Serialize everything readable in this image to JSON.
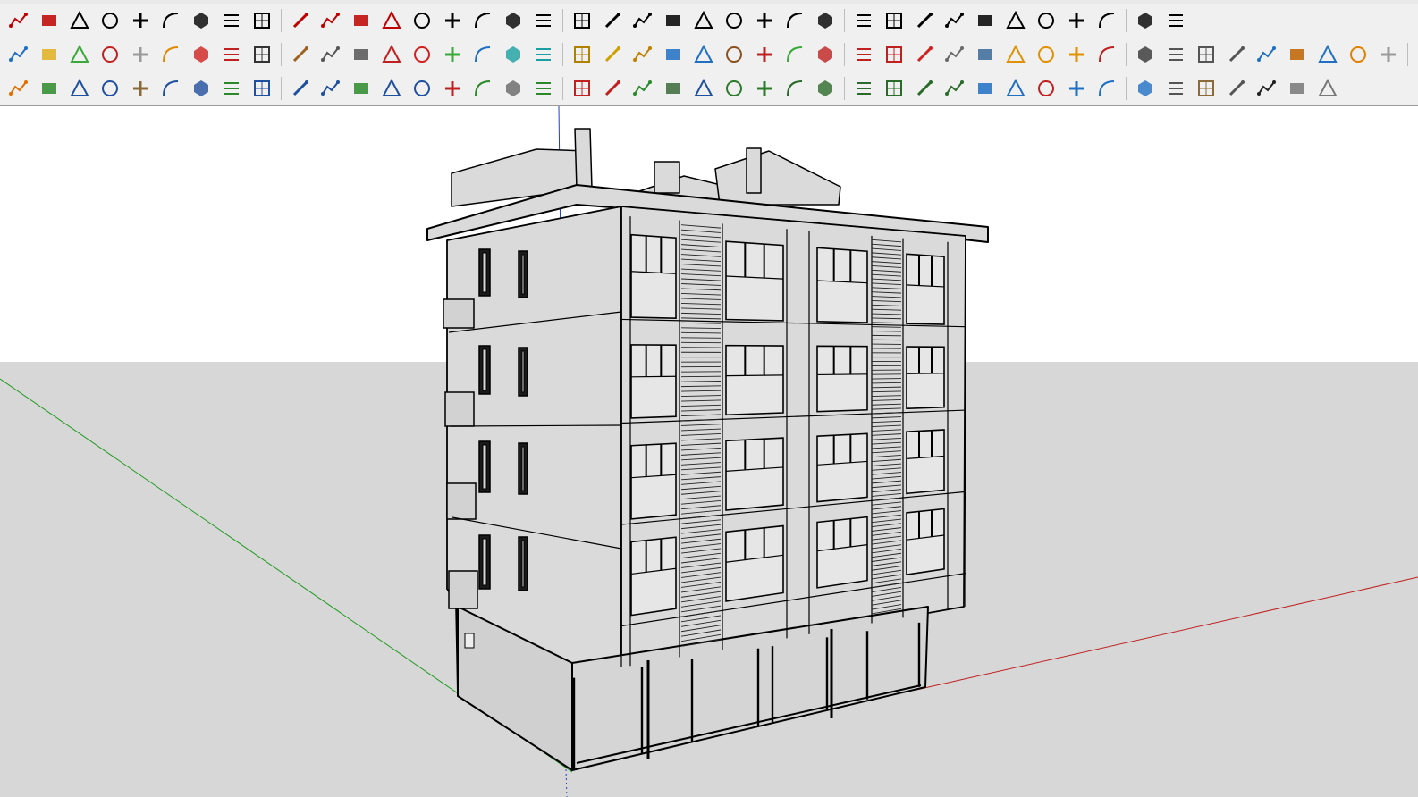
{
  "toolbars": {
    "row1": [
      {
        "id": "arc-tools",
        "color": "#c00000"
      },
      {
        "id": "follow-me",
        "color": "#c00000"
      },
      {
        "id": "erase-lines",
        "color": "#000000"
      },
      {
        "id": "offset",
        "color": "#000000"
      },
      {
        "id": "loft",
        "color": "#000000"
      },
      {
        "id": "twist",
        "color": "#000000"
      },
      {
        "id": "box",
        "color": "#000000"
      },
      {
        "id": "sphere",
        "color": "#000000"
      },
      {
        "id": "push",
        "color": "#000000"
      },
      {
        "id": "fillet-a",
        "color": "#c00000"
      },
      {
        "id": "fillet-b",
        "color": "#c00000"
      },
      {
        "id": "line-angle",
        "color": "#c00000"
      },
      {
        "id": "bezier",
        "color": "#c00000"
      },
      {
        "id": "frame",
        "color": "#000000"
      },
      {
        "id": "pyramid",
        "color": "#000000"
      },
      {
        "id": "stair",
        "color": "#000000"
      },
      {
        "id": "grid-box",
        "color": "#000000"
      },
      {
        "id": "hand",
        "color": "#000000"
      },
      {
        "id": "shade",
        "color": "#000000"
      },
      {
        "id": "extrude",
        "color": "#000000"
      },
      {
        "id": "layers",
        "color": "#000000"
      },
      {
        "id": "slant",
        "color": "#000000"
      },
      {
        "id": "split-a",
        "color": "#000000"
      },
      {
        "id": "split-b",
        "color": "#000000"
      },
      {
        "id": "split-c",
        "color": "#000000"
      },
      {
        "id": "dome",
        "color": "#000000"
      },
      {
        "id": "hatch-a",
        "color": "#000000"
      },
      {
        "id": "sheet",
        "color": "#000000"
      },
      {
        "id": "note",
        "color": "#000000"
      },
      {
        "id": "rack",
        "color": "#000000"
      },
      {
        "id": "cross-a",
        "color": "#000000"
      },
      {
        "id": "stack",
        "color": "#000000"
      },
      {
        "id": "bars",
        "color": "#000000"
      },
      {
        "id": "globe",
        "color": "#000000"
      },
      {
        "id": "star",
        "color": "#000000"
      },
      {
        "id": "slash",
        "color": "#000000"
      },
      {
        "id": "hatch-b",
        "color": "#000000"
      },
      {
        "id": "house",
        "color": "#000000"
      }
    ],
    "row2": [
      {
        "id": "plane-blue",
        "color": "#1f6fc5"
      },
      {
        "id": "plane-yellow",
        "color": "#e0b020"
      },
      {
        "id": "plane-green",
        "color": "#3aa83a"
      },
      {
        "id": "plane-red",
        "color": "#c02020"
      },
      {
        "id": "plane-white",
        "color": "#9a9a9a"
      },
      {
        "id": "rotate-orange",
        "color": "#e08a00"
      },
      {
        "id": "square-red",
        "color": "#d02020"
      },
      {
        "id": "table",
        "color": "#c02020"
      },
      {
        "id": "flag",
        "color": "#333333"
      },
      {
        "id": "book",
        "color": "#a06020"
      },
      {
        "id": "chain",
        "color": "#555555"
      },
      {
        "id": "bend",
        "color": "#555555"
      },
      {
        "id": "nodes",
        "color": "#c02020"
      },
      {
        "id": "plus-red",
        "color": "#d02020"
      },
      {
        "id": "plus-green",
        "color": "#3aa83a"
      },
      {
        "id": "cross-blue",
        "color": "#1f6fc5"
      },
      {
        "id": "cone-teal",
        "color": "#1aa0a0"
      },
      {
        "id": "tree",
        "color": "#1aa0a0"
      },
      {
        "id": "triangle",
        "color": "#b08000"
      },
      {
        "id": "hook-a",
        "color": "#d0a000"
      },
      {
        "id": "hook-b",
        "color": "#c08000"
      },
      {
        "id": "cycle",
        "color": "#1f6fc5"
      },
      {
        "id": "move",
        "color": "#1f6fc5"
      },
      {
        "id": "cube-brown",
        "color": "#8a5020"
      },
      {
        "id": "undo-red",
        "color": "#c02020"
      },
      {
        "id": "puzzle",
        "color": "#3aa83a"
      },
      {
        "id": "export-a",
        "color": "#c02020"
      },
      {
        "id": "export-b",
        "color": "#c02020"
      },
      {
        "id": "export-c",
        "color": "#c02020"
      },
      {
        "id": "gem",
        "color": "#d02020"
      },
      {
        "id": "grid-a",
        "color": "#6a6a6a"
      },
      {
        "id": "screen",
        "color": "#3a6a9a"
      },
      {
        "id": "grid-orange-a",
        "color": "#e09000"
      },
      {
        "id": "grid-orange-b",
        "color": "#e09000"
      },
      {
        "id": "grid-orange-c",
        "color": "#e09000"
      },
      {
        "id": "scatter",
        "color": "#c02020"
      },
      {
        "id": "curve-dots",
        "color": "#333333"
      },
      {
        "id": "grid-b",
        "color": "#555555"
      },
      {
        "id": "pen",
        "color": "#555555"
      },
      {
        "id": "measure",
        "color": "#555555"
      },
      {
        "id": "paint-bucket",
        "color": "#1f6fc5"
      },
      {
        "id": "pencil-orange",
        "color": "#c06000"
      },
      {
        "id": "cube-blue",
        "color": "#1f6fc5"
      },
      {
        "id": "arrow-orange",
        "color": "#e08000"
      },
      {
        "id": "eraser-gray",
        "color": "#9a9a9a"
      },
      {
        "id": "scale",
        "color": "#555555"
      }
    ],
    "row3": [
      {
        "id": "lock-orange",
        "color": "#e07000"
      },
      {
        "id": "mesh-green",
        "color": "#2a8a2a"
      },
      {
        "id": "curve-arch",
        "color": "#1f4f9f"
      },
      {
        "id": "curve-n",
        "color": "#1f4f9f"
      },
      {
        "id": "curve-hatch",
        "color": "#8a6a3a"
      },
      {
        "id": "curve-s",
        "color": "#1f4f9f"
      },
      {
        "id": "curve-i",
        "color": "#1f4f9f"
      },
      {
        "id": "curve-c-green",
        "color": "#2a8a2a"
      },
      {
        "id": "rect-blue",
        "color": "#1f4f9f"
      },
      {
        "id": "spiral",
        "color": "#1f4f9f"
      },
      {
        "id": "arc-blue",
        "color": "#1f4f9f"
      },
      {
        "id": "zigzag-green",
        "color": "#2a8a2a"
      },
      {
        "id": "hook-blue",
        "color": "#1f4f9f"
      },
      {
        "id": "curve-r",
        "color": "#1f4f9f"
      },
      {
        "id": "curve-red",
        "color": "#c02020"
      },
      {
        "id": "line-green",
        "color": "#2a8a2a"
      },
      {
        "id": "polygon",
        "color": "#666666"
      },
      {
        "id": "wrench",
        "color": "#2a8a2a"
      },
      {
        "id": "ellipse",
        "color": "#c02020"
      },
      {
        "id": "pie",
        "color": "#c02020"
      },
      {
        "id": "terrain-a",
        "color": "#2a8a2a"
      },
      {
        "id": "terrain-b",
        "color": "#3a6a3a"
      },
      {
        "id": "select-arrow",
        "color": "#1f4f9f"
      },
      {
        "id": "scale-up",
        "color": "#2a7a2a"
      },
      {
        "id": "scale-down",
        "color": "#2a7a2a"
      },
      {
        "id": "lines-a",
        "color": "#2a6a2a"
      },
      {
        "id": "lines-b",
        "color": "#2a6a2a"
      },
      {
        "id": "lines-c",
        "color": "#2a6a2a"
      },
      {
        "id": "dash-a",
        "color": "#2a6a2a"
      },
      {
        "id": "dash-b",
        "color": "#2a6a2a"
      },
      {
        "id": "dash-c",
        "color": "#2a6a2a"
      },
      {
        "id": "panel-a",
        "color": "#1f6fc5"
      },
      {
        "id": "panel-b",
        "color": "#1f6fc5"
      },
      {
        "id": "panel-c",
        "color": "#c02020"
      },
      {
        "id": "window-a",
        "color": "#1f6fc5"
      },
      {
        "id": "window-b",
        "color": "#1f6fc5"
      },
      {
        "id": "window-c",
        "color": "#1f6fc5"
      },
      {
        "id": "tile-a",
        "color": "#555555"
      },
      {
        "id": "tile-b",
        "color": "#8a6a3a"
      },
      {
        "id": "tile-c",
        "color": "#555555"
      },
      {
        "id": "checker",
        "color": "#222222"
      },
      {
        "id": "copy",
        "color": "#777777"
      },
      {
        "id": "paste",
        "color": "#777777"
      }
    ]
  },
  "viewport": {
    "background_sky": "#ffffff",
    "background_ground": "#d7d7d7",
    "model_face_color": "#dadada",
    "model_edge_color": "#000000",
    "axis_green": "#1c9a1c",
    "axis_red": "#c02020",
    "axis_blue": "#1f3fd0"
  }
}
